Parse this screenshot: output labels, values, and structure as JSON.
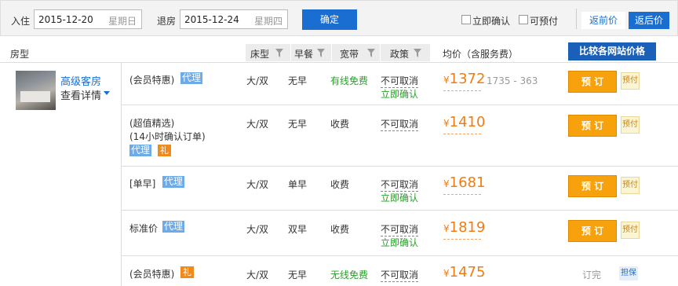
{
  "search": {
    "checkin_label": "入住",
    "checkin_date": "2015-12-20",
    "checkin_weekday": "星期日",
    "checkout_label": "退房",
    "checkout_date": "2015-12-24",
    "checkout_weekday": "星期四",
    "confirm_label": "确定",
    "instant_confirm_label": "立即确认",
    "bookable_label": "可预付",
    "pre_tax_label": "返前价",
    "post_tax_label": "返后价"
  },
  "header": {
    "room_type": "房型",
    "bed": "床型",
    "breakfast": "早餐",
    "broadband": "宽带",
    "policy": "政策",
    "avg_price": "均价（含服务费）",
    "compare_button": "比较各网站价格"
  },
  "room": {
    "name": "高级客房",
    "detail": "查看详情"
  },
  "rates": [
    {
      "name": "(会员特惠)",
      "tag_agent": "代理",
      "tag_gift": "",
      "bed": "大/双",
      "breakfast": "无早",
      "broadband": "有线免费",
      "policy": "不可取消",
      "confirm": "立即确认",
      "currency": "¥",
      "price": "1372",
      "range": "1735 - 363",
      "action": "预 订",
      "badge": "预付"
    },
    {
      "name": "(超值精选)",
      "name2": "(14小时确认订单)",
      "tag_agent": "代理",
      "tag_gift": "礼",
      "bed": "大/双",
      "breakfast": "无早",
      "broadband": "收费",
      "policy": "不可取消",
      "confirm": "",
      "currency": "¥",
      "price": "1410",
      "range": "",
      "action": "预 订",
      "badge": "预付"
    },
    {
      "name": "[单早]",
      "tag_agent": "代理",
      "tag_gift": "",
      "bed": "大/双",
      "breakfast": "单早",
      "broadband": "收费",
      "policy": "不可取消",
      "confirm": "立即确认",
      "currency": "¥",
      "price": "1681",
      "range": "",
      "action": "预 订",
      "badge": "预付"
    },
    {
      "name": "标准价",
      "tag_agent": "代理",
      "tag_gift": "",
      "bed": "大/双",
      "breakfast": "双早",
      "broadband": "收费",
      "policy": "不可取消",
      "confirm": "立即确认",
      "currency": "¥",
      "price": "1819",
      "range": "",
      "action": "预 订",
      "badge": "预付"
    },
    {
      "name": "(会员特惠)",
      "tag_agent": "",
      "tag_gift": "礼",
      "bed": "大/双",
      "breakfast": "无早",
      "broadband": "无线免费",
      "policy": "不可取消",
      "confirm": "",
      "currency": "¥",
      "price": "1475",
      "range": "",
      "action": "订完",
      "badge": "担保"
    }
  ]
}
